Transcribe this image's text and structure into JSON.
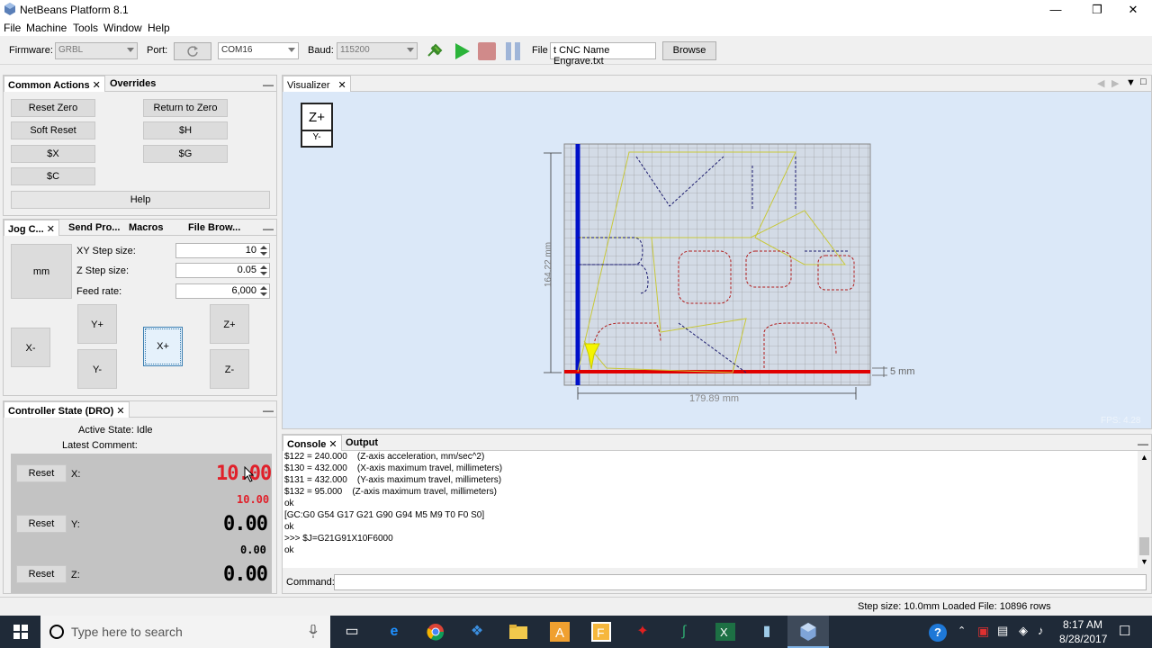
{
  "window": {
    "title": "NetBeans Platform 8.1"
  },
  "menu": [
    "File",
    "Machine",
    "Tools",
    "Window",
    "Help"
  ],
  "toolbar": {
    "firmware_label": "Firmware:",
    "firmware_value": "GRBL",
    "port_label": "Port:",
    "port_value": "COM16",
    "baud_label": "Baud:",
    "baud_value": "115200",
    "file_label": "File",
    "file_value": "t CNC Name Engrave.txt",
    "browse_label": "Browse"
  },
  "common_actions": {
    "tabs": [
      "Common Actions",
      "Overrides"
    ],
    "buttons": [
      "Reset Zero",
      "Return to Zero",
      "Soft Reset",
      "$H",
      "$X",
      "$G",
      "$C"
    ],
    "help_label": "Help"
  },
  "jog": {
    "tabs": [
      "Jog C...",
      "Send Pro...",
      "Macros",
      "File Brow..."
    ],
    "unit_label": "mm",
    "xy_step_label": "XY Step size:",
    "xy_step_value": "10",
    "z_step_label": "Z Step size:",
    "z_step_value": "0.05",
    "feed_label": "Feed rate:",
    "feed_value": "6,000",
    "buttons": {
      "xminus": "X-",
      "yplus": "Y+",
      "yminus": "Y-",
      "xplus": "X+",
      "zplus": "Z+",
      "zminus": "Z-"
    }
  },
  "dro": {
    "tab": "Controller State (DRO)",
    "active_state": "Active State: Idle",
    "latest_comment": "Latest Comment:",
    "reset_label": "Reset",
    "x_label": "X:",
    "x_work": "10.00",
    "x_machine": "10.00",
    "y_label": "Y:",
    "y_work": "0.00",
    "y_machine": "0.00",
    "z_label": "Z:",
    "z_work": "0.00",
    "colors": {
      "highlight": "#e0202a",
      "normal": "#000000"
    }
  },
  "visualizer": {
    "tab": "Visualizer",
    "view_top": "Z+",
    "view_bottom": "Y-",
    "width_dim": "179.89 mm",
    "height_dim": "164.22 mm",
    "scale_label": "5 mm",
    "fps": "FPS: 4.28"
  },
  "console": {
    "tabs": [
      "Console",
      "Output"
    ],
    "lines": [
      "$122 = 240.000    (Z-axis acceleration, mm/sec^2)",
      "$130 = 432.000    (X-axis maximum travel, millimeters)",
      "$131 = 432.000    (Y-axis maximum travel, millimeters)",
      "$132 = 95.000    (Z-axis maximum travel, millimeters)",
      "ok",
      "[GC:G0 G54 G17 G21 G90 G94 M5 M9 T0 F0 S0]",
      "ok",
      ">>> $J=G21G91X10F6000",
      "ok"
    ],
    "command_label": "Command:"
  },
  "status": {
    "text": "Step size: 10.0mm Loaded File: 10896 rows"
  },
  "taskbar": {
    "search_placeholder": "Type here to search",
    "time": "8:17 AM",
    "date": "8/28/2017"
  }
}
